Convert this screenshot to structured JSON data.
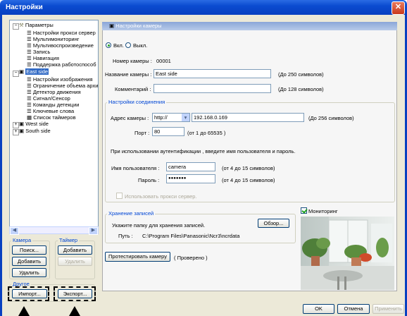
{
  "window": {
    "title": "Настройки",
    "close_glyph": "✕"
  },
  "tree": {
    "root": "Параметры",
    "root_children": [
      "Настройки прокси сервер",
      "Мультимониторинг",
      "Мультивоспроизведение",
      "Запись",
      "Навигация",
      "Поддержка работоспособ"
    ],
    "east": "East side",
    "east_children": [
      "Настройки изображения",
      "Ограничение объема архи",
      "Детектор движения",
      "Сигнал/Сенсор",
      "Команды детекции",
      "Ключевые слова"
    ],
    "timer_list": "Список таймеров",
    "west": "West side",
    "south": "South side"
  },
  "left_groups": {
    "camera_label": "Камера",
    "timer_label": "Таймер",
    "search": "Поиск...",
    "add_camera": "Добавить",
    "delete_camera": "Удалить",
    "add_timer": "Добавить",
    "delete_timer": "Удалить",
    "other_label": "Другое",
    "import": "Импорт...",
    "export": "Экспорт..."
  },
  "panel": {
    "header": "Настройки камеры",
    "on": "Вкл.",
    "off": "Выкл.",
    "camera_number_label": "Номер камеры :",
    "camera_number": "00001",
    "camera_name_label": "Название камеры :",
    "camera_name": "East side",
    "camera_name_hint": "(До 250 символов)",
    "comment_label": "Комментарий :",
    "comment": "",
    "comment_hint": "(До 128 символов)",
    "conn_group": "Настройки соединения",
    "address_label": "Адрес камеры :",
    "protocol": "http://",
    "address": "192.168.0.169",
    "address_hint": "(До 256 символов)",
    "port_label": "Порт :",
    "port": "80",
    "port_hint": "(от 1 до 65535 )",
    "auth_note": "При использовании аутентификации , введите имя пользователя и пароль.",
    "user_label": "Имя пользователя :",
    "user": "camera",
    "user_hint": "(от 4 до 15 символов)",
    "password_label": "Пароль :",
    "password": "●●●●●●●",
    "password_hint": "(от 4 до 15 символов)",
    "proxy_label": "Использовать прокси сервер.",
    "storage_group": "Хранение записей",
    "storage_note": "Укажите папку для хранения записей.",
    "browse": "Обзор...",
    "path_label": "Путь :",
    "path": "C:\\Program Files\\Panasonic\\Ncr3\\ncrdata",
    "test_button": "Протестировать камеру",
    "test_status": "( Проверено )",
    "monitoring": "Мониторинг"
  },
  "footer": {
    "ok": "OK",
    "cancel": "Отмена",
    "apply": "Применить"
  },
  "colors": {
    "accent": "#0a4bd0",
    "selection": "#316ac5",
    "group_label": "#0046d5"
  }
}
